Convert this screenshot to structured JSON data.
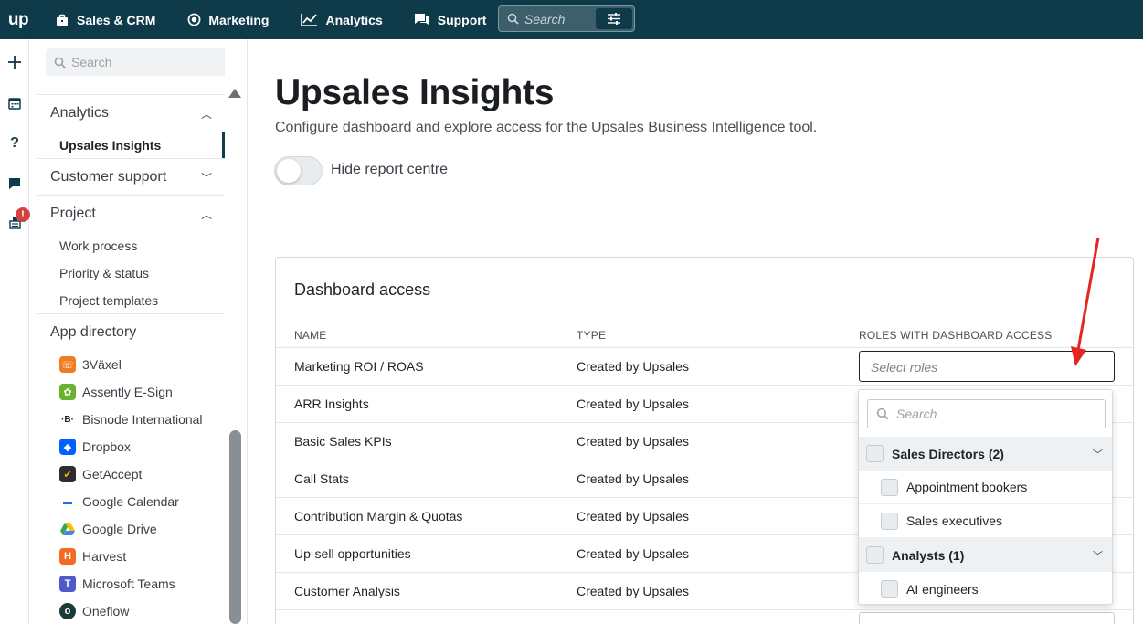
{
  "topbar": {
    "logo": "up",
    "nav": [
      {
        "label": "Sales & CRM",
        "icon": "briefcase-icon"
      },
      {
        "label": "Marketing",
        "icon": "target-icon"
      },
      {
        "label": "Analytics",
        "icon": "chart-line-icon"
      },
      {
        "label": "Support",
        "icon": "chat-icon"
      }
    ],
    "search_placeholder": "Search",
    "accent": "#0e3a4a"
  },
  "rail": {
    "icons": [
      "plus-icon",
      "calendar-icon",
      "help-icon",
      "message-icon",
      "notifications-icon"
    ],
    "badge": "!"
  },
  "sidebar": {
    "search_placeholder": "Search",
    "sections": {
      "analytics": {
        "label": "Analytics",
        "items": [
          "Upsales Insights"
        ]
      },
      "customer_support": {
        "label": "Customer support"
      },
      "project": {
        "label": "Project",
        "items": [
          "Work process",
          "Priority & status",
          "Project templates"
        ]
      },
      "app_directory": {
        "label": "App directory",
        "apps": [
          "3Växel",
          "Assently E-Sign",
          "Bisnode International",
          "Dropbox",
          "GetAccept",
          "Google Calendar",
          "Google Drive",
          "Harvest",
          "Microsoft Teams",
          "Oneflow"
        ]
      }
    }
  },
  "main": {
    "title": "Upsales Insights",
    "subtitle": "Configure dashboard and explore access for the Upsales Business Intelligence tool.",
    "toggle_label": "Hide report centre",
    "toggle_on": false,
    "card": {
      "title": "Dashboard access",
      "columns": [
        "NAME",
        "TYPE",
        "ROLES WITH DASHBOARD ACCESS"
      ],
      "rows": [
        {
          "name": "Marketing ROI / ROAS",
          "type": "Created by Upsales"
        },
        {
          "name": "ARR Insights",
          "type": "Created by Upsales"
        },
        {
          "name": "Basic Sales KPIs",
          "type": "Created by Upsales"
        },
        {
          "name": "Call Stats",
          "type": "Created by Upsales"
        },
        {
          "name": "Contribution Margin & Quotas",
          "type": "Created by Upsales"
        },
        {
          "name": "Up-sell opportunities",
          "type": "Created by Upsales"
        },
        {
          "name": "Customer Analysis",
          "type": "Created by Upsales"
        }
      ],
      "select_placeholder": "Select roles"
    },
    "dropdown": {
      "search_placeholder": "Search",
      "groups": [
        {
          "label": "Sales Directors (2)",
          "options": [
            "Appointment bookers",
            "Sales executives"
          ]
        },
        {
          "label": "Analysts (1)",
          "options": [
            "AI engineers"
          ]
        }
      ]
    }
  }
}
